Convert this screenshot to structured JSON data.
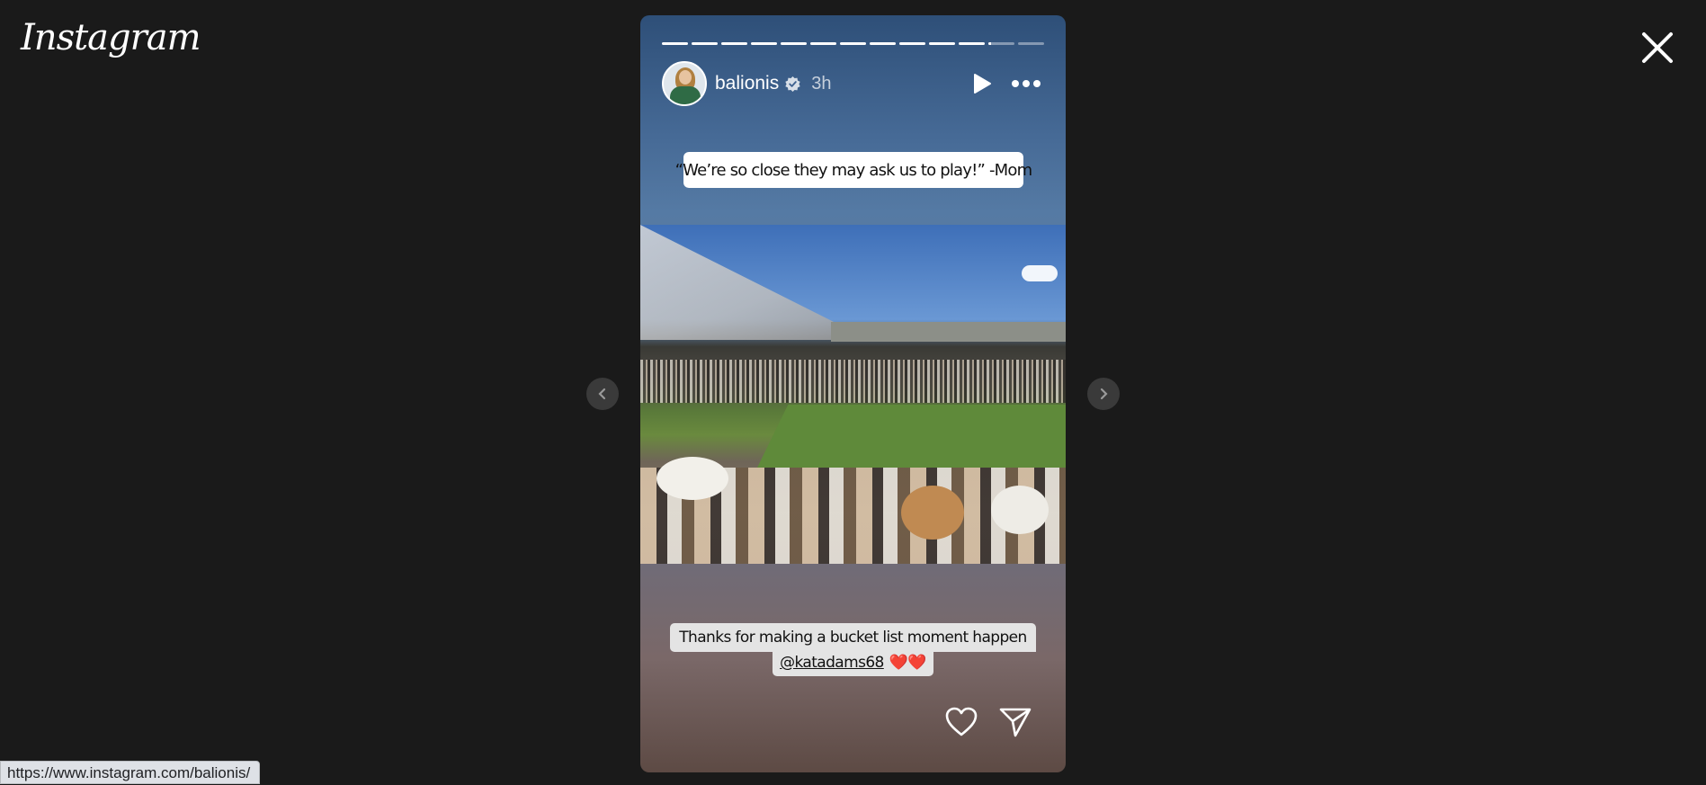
{
  "brand": {
    "logo_text": "Instagram"
  },
  "story": {
    "username": "balionis",
    "verified": true,
    "time_ago": "3h",
    "progress": {
      "segments": 13,
      "completed": 11,
      "current_fraction": 0.1
    },
    "caption_top": "“We’re so close they may ask us to play!” -Mom",
    "caption_bottom": {
      "line1": "Thanks for making a bucket list moment happen",
      "mention": "@katadams68",
      "emoji": "❤️❤️"
    }
  },
  "icons": {
    "close": "close-icon",
    "prev": "chevron-left-icon",
    "next": "chevron-right-icon",
    "play": "play-icon",
    "more": "more-horizontal-icon",
    "like": "heart-icon",
    "share": "send-icon",
    "verified": "verified-badge-icon"
  },
  "status_bar": {
    "url": "https://www.instagram.com/balionis/"
  }
}
